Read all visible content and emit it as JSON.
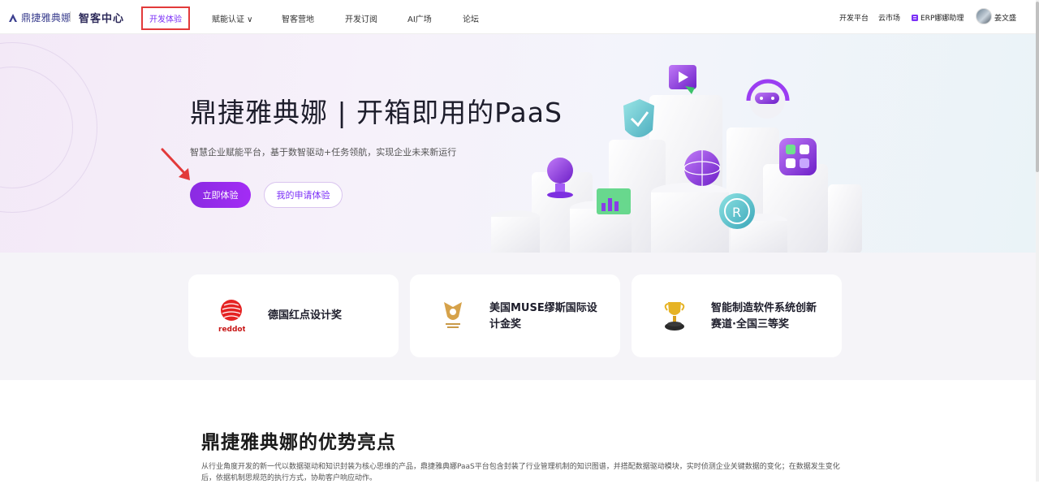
{
  "nav": {
    "brand": "鼎捷雅典娜",
    "subbrand": "智客中心",
    "items": [
      {
        "label": "开发体验",
        "active": true
      },
      {
        "label": "赋能认证 ∨"
      },
      {
        "label": "智客营地"
      },
      {
        "label": "开发订阅"
      },
      {
        "label": "AI广场"
      },
      {
        "label": "论坛"
      }
    ],
    "right": {
      "dev_platform": "开发平台",
      "cloud_market": "云市场",
      "assistant": "ERP娜娜助理",
      "user": "姜文盛"
    }
  },
  "hero": {
    "title": "鼎捷雅典娜 | 开箱即用的PaaS",
    "subtitle": "智慧企业赋能平台，基于数智驱动+任务领航，实现企业未来新运行",
    "primary_button": "立即体验",
    "secondary_button": "我的申请体验"
  },
  "awards": [
    {
      "title": "德国红点设计奖",
      "logo": "reddot"
    },
    {
      "title": "美国MUSE缪斯国际设计金奖",
      "logo": "muse-awards-icon"
    },
    {
      "title": "智能制造软件系统创新赛道·全国三等奖",
      "logo": "trophy-icon"
    }
  ],
  "advantages": {
    "title": "鼎捷雅典娜的优势亮点",
    "description": "从行业角度开发的新一代以数据驱动和知识封装为核心思维的产品，鼎捷雅典娜PaaS平台包含封装了行业管理机制的知识图谱，并搭配数据驱动模块，实时侦测企业关键数据的变化；在数据发生变化后，依据机制思规范的执行方式，协助客户响应动作。"
  },
  "colors": {
    "accent": "#7b2ff7",
    "highlight_box": "#e23a3a",
    "hero_bg": "#f3e9f7"
  }
}
